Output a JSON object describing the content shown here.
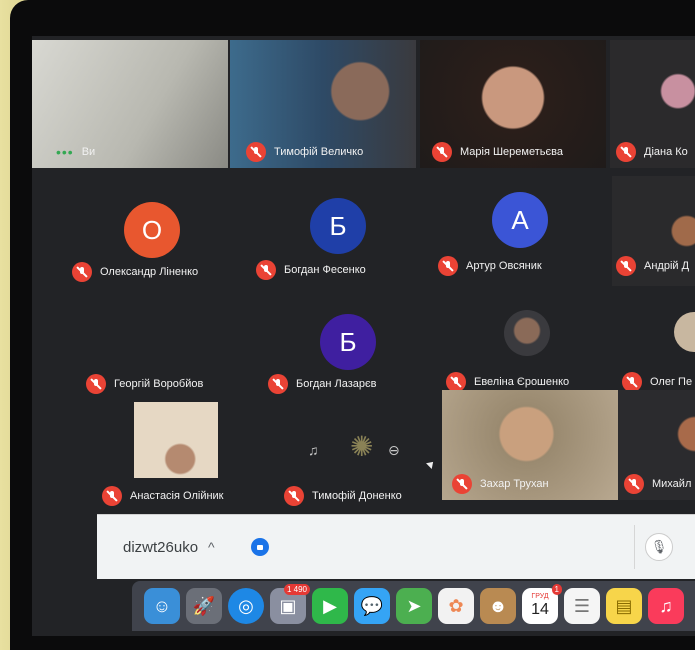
{
  "participants": [
    {
      "name": "Ви"
    },
    {
      "name": "Тимофій Величко"
    },
    {
      "name": "Марія Шереметьєва"
    },
    {
      "name": "Діана Ко"
    },
    {
      "name": "Олександр Ліненко",
      "initial": "О",
      "color": "#e8572f"
    },
    {
      "name": "Богдан Фесенко",
      "initial": "Б",
      "color": "#1f3fa8"
    },
    {
      "name": "Артур Овсяник",
      "initial": "А",
      "color": "#3b55d6"
    },
    {
      "name": "Андрій Д"
    },
    {
      "name": "Георгій Воробйов"
    },
    {
      "name": "Богдан Лазарєв",
      "initial": "Б",
      "color": "#3f1fa0"
    },
    {
      "name": "Евеліна Єрошенко"
    },
    {
      "name": "Олег Пе"
    },
    {
      "name": "Анастасія Олійник"
    },
    {
      "name": "Тимофій Доненко"
    },
    {
      "name": "Захар Трухан"
    },
    {
      "name": "Михайл"
    }
  ],
  "download_bar": {
    "filename": "dizwt26uko",
    "caret": "^"
  },
  "dock": {
    "icons": [
      {
        "name": "finder",
        "glyph": "☺",
        "color": "#3a8fd8"
      },
      {
        "name": "launchpad",
        "glyph": "🚀",
        "color": "#6b6f78"
      },
      {
        "name": "safari",
        "glyph": "◎",
        "color": "#1e88e5"
      },
      {
        "name": "photos-app",
        "glyph": "▣",
        "color": "#8a8fa0",
        "badge": "1 490"
      },
      {
        "name": "facetime",
        "glyph": "▶",
        "color": "#2fb84a"
      },
      {
        "name": "messages",
        "glyph": "💬",
        "color": "#35a4f5"
      },
      {
        "name": "maps",
        "glyph": "➤",
        "color": "#4caf50"
      },
      {
        "name": "photos",
        "glyph": "✿",
        "color": "#f2f2f2"
      },
      {
        "name": "contacts",
        "glyph": "☻",
        "color": "#b98a52"
      },
      {
        "name": "calendar",
        "month": "ГРУД",
        "day": "14",
        "badge": "1"
      },
      {
        "name": "reminders",
        "glyph": "☰",
        "color": "#f5f5f5"
      },
      {
        "name": "notes",
        "glyph": "▤",
        "color": "#f7d54a"
      },
      {
        "name": "music",
        "glyph": "♫",
        "color": "#fa3b5b"
      }
    ]
  }
}
